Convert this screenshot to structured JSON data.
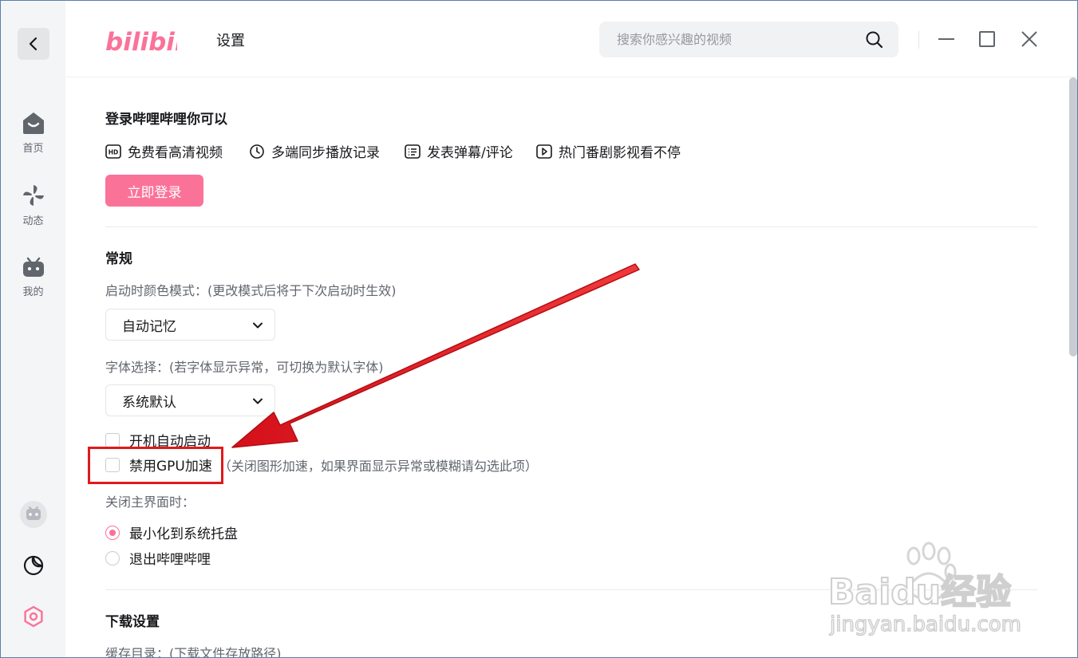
{
  "header": {
    "logo_text": "bilibili",
    "title": "设置",
    "search_placeholder": "搜索你感兴趣的视频"
  },
  "sidebar": {
    "items": [
      {
        "label": "首页",
        "icon": "home-icon"
      },
      {
        "label": "动态",
        "icon": "pinwheel-icon"
      },
      {
        "label": "我的",
        "icon": "tv-icon"
      }
    ]
  },
  "login": {
    "title": "登录哔哩哔哩你可以",
    "features": [
      "免费看高清视频",
      "多端同步播放记录",
      "发表弹幕/评论",
      "热门番剧影视看不停"
    ],
    "button": "立即登录"
  },
  "general": {
    "title": "常规",
    "color_mode_label": "启动时颜色模式：(更改模式后将于下次启动时生效)",
    "color_mode_value": "自动记忆",
    "font_label": "字体选择：(若字体显示异常，可切换为默认字体)",
    "font_value": "系统默认",
    "autostart_label": "开机自动启动",
    "disable_gpu_label": "禁用GPU加速",
    "disable_gpu_hint": "（关闭图形加速，如果界面显示异常或模糊请勾选此项）",
    "close_label": "关闭主界面时：",
    "close_options": [
      "最小化到系统托盘",
      "退出哔哩哔哩"
    ]
  },
  "download": {
    "title": "下载设置",
    "cache_label": "缓存目录：(下载文件存放路径)"
  },
  "watermark": {
    "brand": "Baidu经验",
    "url": "jingyan.baidu.com"
  },
  "colors": {
    "accent": "#fb7299",
    "annotation": "#e0191c"
  }
}
